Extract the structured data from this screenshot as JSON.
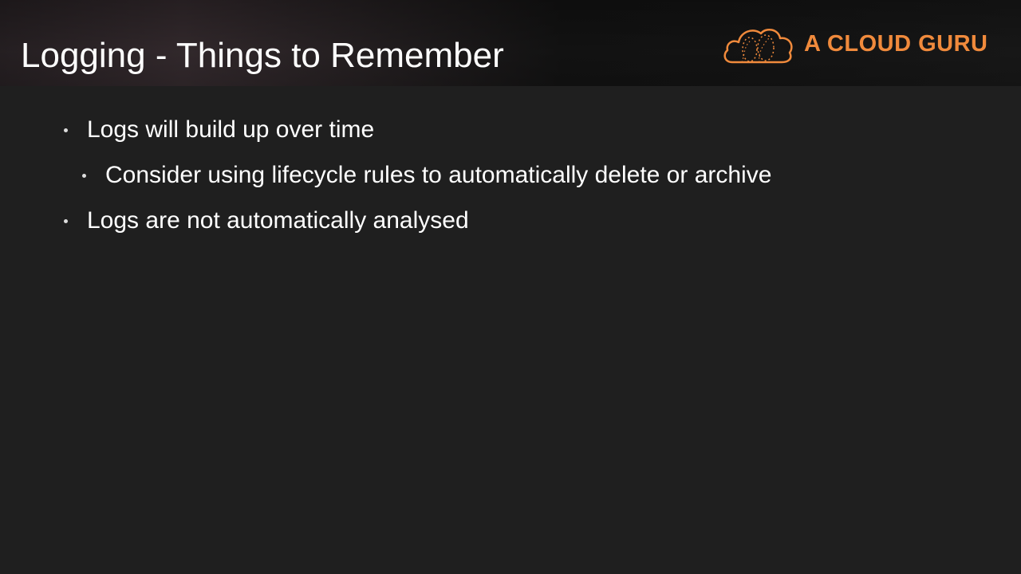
{
  "slide": {
    "title": "Logging - Things to Remember",
    "brand": {
      "name": "A CLOUD GURU",
      "logo_icon": "cloud-logo-icon",
      "color": "#f08a3c"
    },
    "bullets": [
      {
        "level": 1,
        "text": "Logs will build up over time"
      },
      {
        "level": 2,
        "text": "Consider using lifecycle rules to automatically delete or archive"
      },
      {
        "level": 1,
        "text": "Logs are not automatically analysed"
      }
    ]
  },
  "colors": {
    "background": "#1f1f1f",
    "text": "#ffffff",
    "accent": "#f08a3c"
  }
}
